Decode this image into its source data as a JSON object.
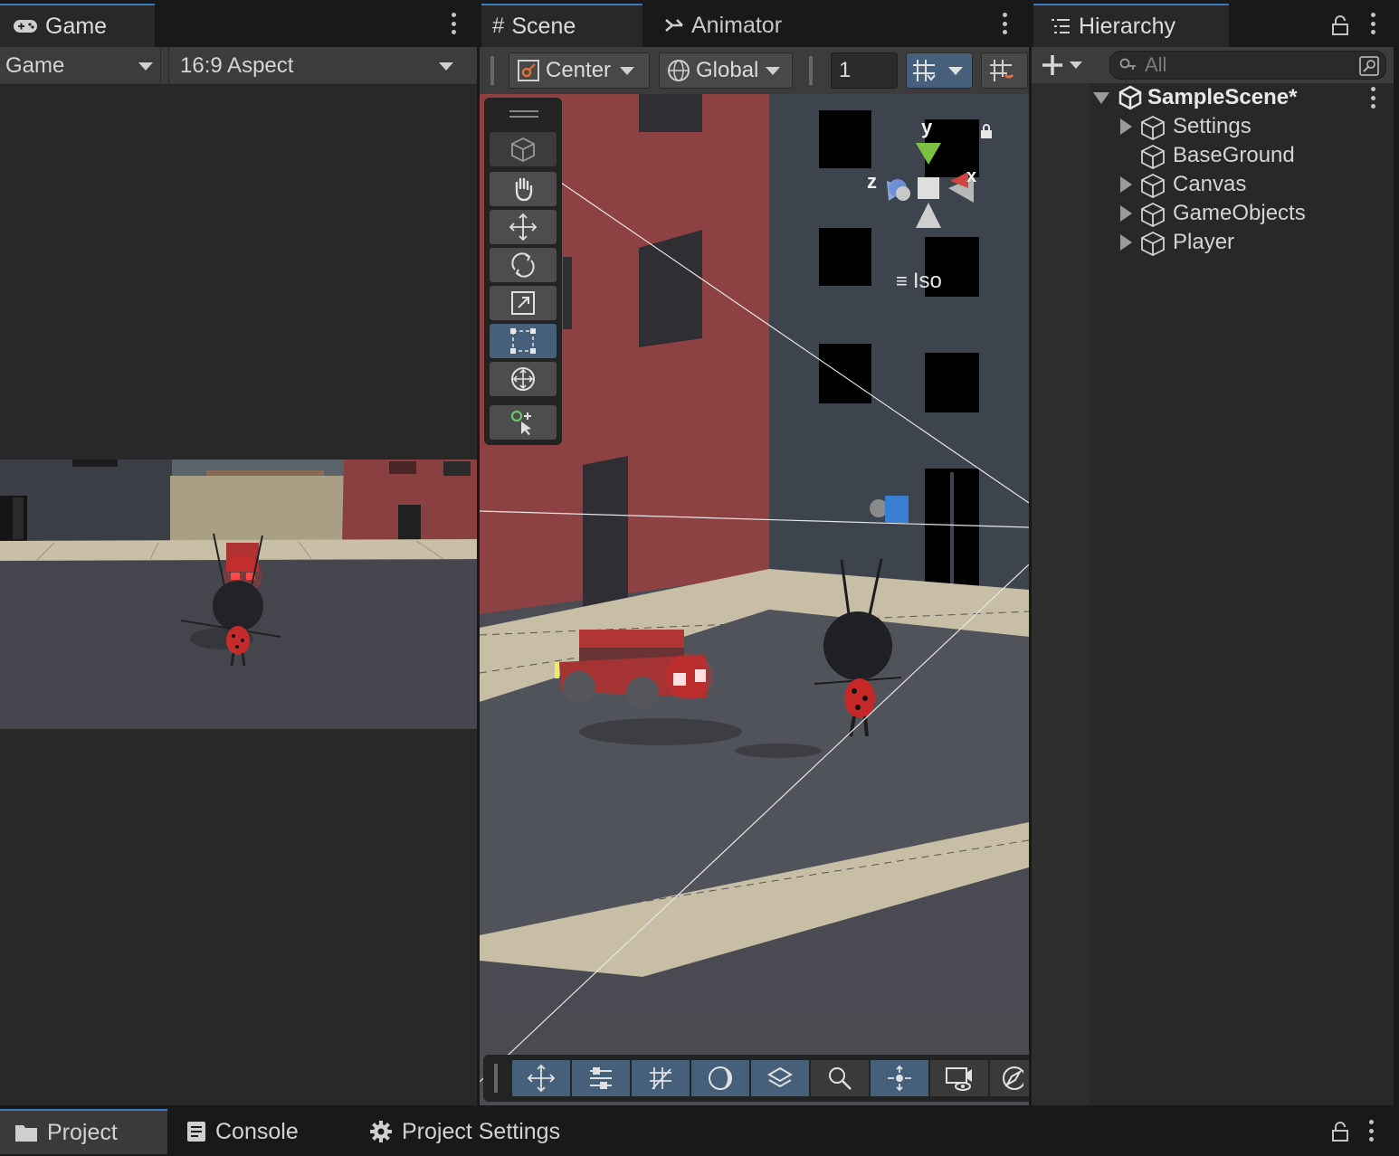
{
  "game": {
    "tab_label": "Game",
    "tab_icon": "gamepad-icon",
    "display_dropdown": "Game",
    "aspect_dropdown": "16:9 Aspect"
  },
  "scene": {
    "tab_label": "Scene",
    "tab_icon": "grid-hash-icon",
    "animator_tab_label": "Animator",
    "animator_tab_icon": "animator-icon",
    "pivot_dropdown": "Center",
    "space_dropdown": "Global",
    "snap_value": "1",
    "gizmo": {
      "y_label": "y",
      "x_label": "x",
      "z_label": "z",
      "projection_label": "Iso"
    },
    "tools": [
      "view-tool",
      "hand-tool",
      "move-tool",
      "rotate-tool",
      "scale-tool",
      "rect-tool",
      "transform-tool",
      "custom-tool"
    ],
    "active_tool": "rect-tool",
    "overlays": [
      "move-overlay",
      "settings-overlay",
      "grid-overlay",
      "shading-overlay",
      "layers-overlay",
      "search-overlay",
      "orbit-overlay",
      "camera-overlay",
      "compass-overlay"
    ]
  },
  "hierarchy": {
    "tab_label": "Hierarchy",
    "search_placeholder": "All",
    "scene_name": "SampleScene*",
    "items": [
      {
        "label": "Settings",
        "expandable": true
      },
      {
        "label": "BaseGround",
        "expandable": false
      },
      {
        "label": "Canvas",
        "expandable": true
      },
      {
        "label": "GameObjects",
        "expandable": true
      },
      {
        "label": "Player",
        "expandable": true
      }
    ]
  },
  "bottom_tabs": [
    {
      "label": "Project",
      "icon": "folder-icon"
    },
    {
      "label": "Console",
      "icon": "console-icon"
    },
    {
      "label": "Project Settings",
      "icon": "gear-icon"
    }
  ],
  "colors": {
    "accent": "#3a79bb",
    "active_button": "#46607c",
    "panel": "#282828",
    "toolbar": "#3c3c3c"
  }
}
